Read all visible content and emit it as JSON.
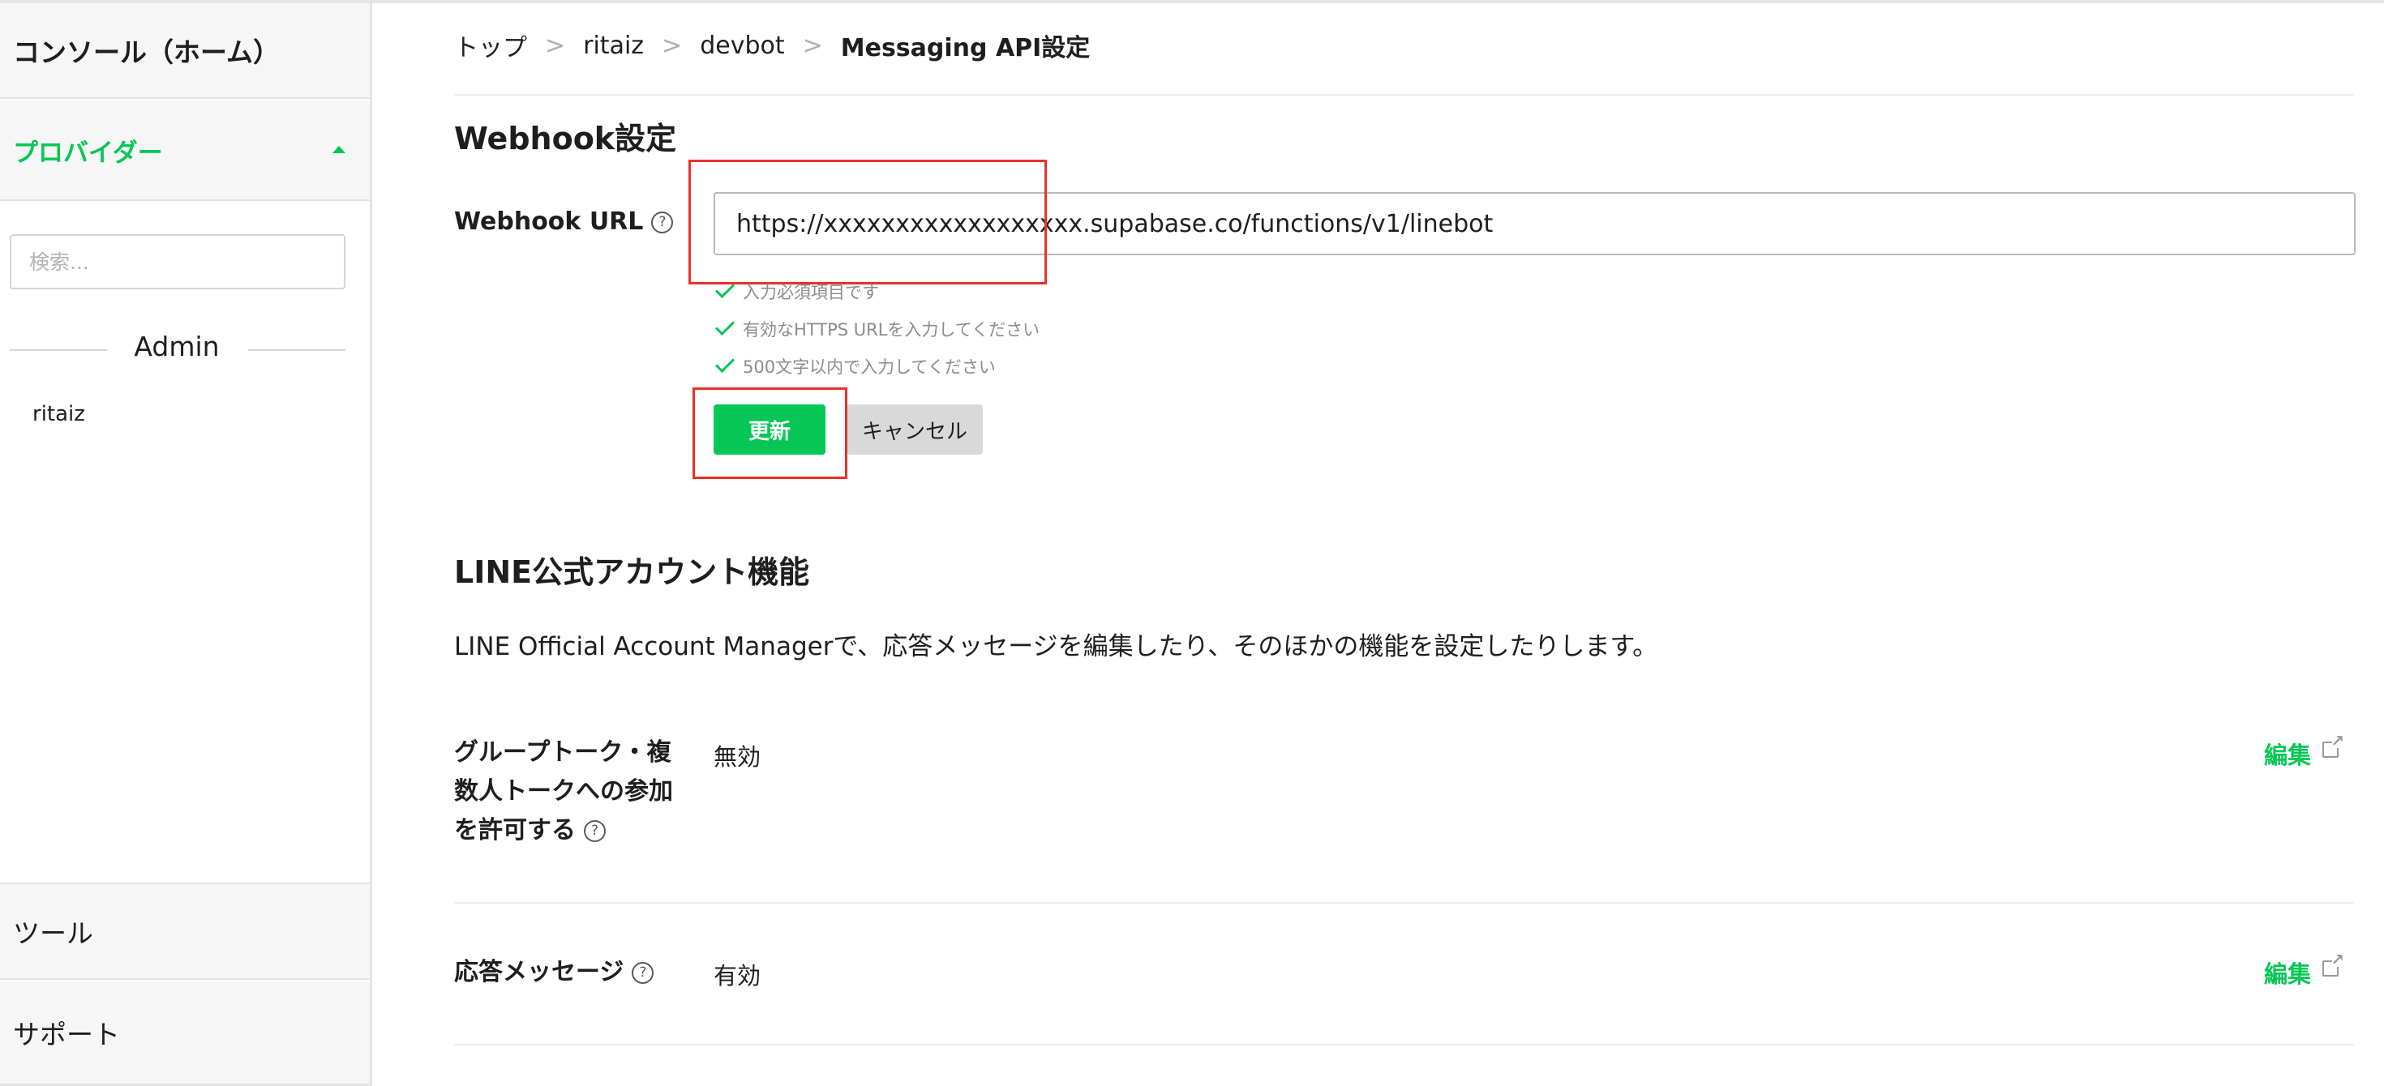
{
  "sidebar": {
    "home_label": "コンソール（ホーム）",
    "provider_section_label": "プロバイダー",
    "search_placeholder": "検索...",
    "admin_heading": "Admin",
    "provider_item": "ritaiz",
    "tools_label": "ツール",
    "support_label": "サポート"
  },
  "breadcrumb": {
    "items": [
      "トップ",
      "ritaiz",
      "devbot",
      "Messaging API設定"
    ],
    "separator": ">"
  },
  "webhook": {
    "section_title": "Webhook設定",
    "url_label": "Webhook URL",
    "url_value": "https://xxxxxxxxxxxxxxxxxx.supabase.co/functions/v1/linebot",
    "validations": [
      "入力必須項目です",
      "有効なHTTPS URLを入力してください",
      "500文字以内で入力してください"
    ],
    "update_label": "更新",
    "cancel_label": "キャンセル"
  },
  "oa_features": {
    "section_title": "LINE公式アカウント機能",
    "description": "LINE Official Account Managerで、応答メッセージを編集したり、そのほかの機能を設定したりします。",
    "settings": [
      {
        "label_lines": [
          "グループトーク・複",
          "数人トークへの参加",
          "を許可する"
        ],
        "value": "無効",
        "edit_label": "編集"
      },
      {
        "label_lines": [
          "応答メッセージ"
        ],
        "value": "有効",
        "edit_label": "編集"
      }
    ]
  },
  "help_glyph": "?",
  "colors": {
    "accent_green": "#06c755",
    "highlight_red": "#e8322a",
    "sidebar_bg": "#f6f6f7"
  }
}
